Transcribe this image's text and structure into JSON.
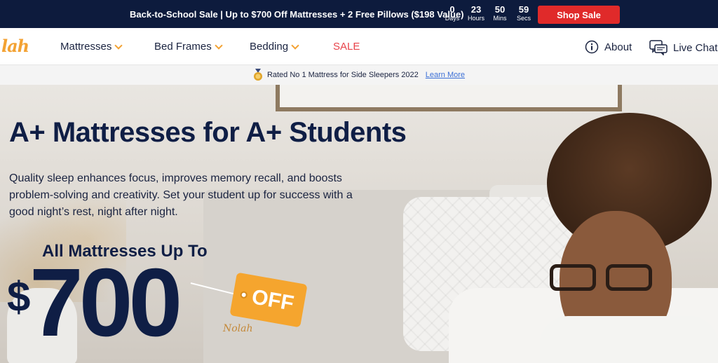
{
  "promo": {
    "text": "Back-to-School Sale | Up to $700 Off Mattresses + 2 Free Pillows ($198 Value)",
    "timer": [
      {
        "value": "0",
        "label": "Days"
      },
      {
        "value": "23",
        "label": "Hours"
      },
      {
        "value": "50",
        "label": "Mins"
      },
      {
        "value": "59",
        "label": "Secs"
      }
    ],
    "button": "Shop Sale",
    "button_color": "#e02a2a",
    "bg_color": "#0d1b3d"
  },
  "nav": {
    "logo": "lah",
    "items": [
      {
        "label": "Mattresses"
      },
      {
        "label": "Bed Frames"
      },
      {
        "label": "Bedding"
      },
      {
        "label": "SALE"
      }
    ],
    "about": "About",
    "chat": "Live Chat",
    "accent_color": "#f3a233",
    "sale_color": "#e8444b"
  },
  "rating": {
    "text": "Rated No 1 Mattress for Side Sleepers 2022",
    "link": "Learn More",
    "icon": "award-medal-icon"
  },
  "hero": {
    "title": "A+ Mattresses for A+ Students",
    "description": "Quality sleep enhances focus, improves memory recall, and boosts problem-solving and creativity. Set your student up for success with a good night’s rest, night after night.",
    "upto": "All Mattresses Up To",
    "dollar": "$",
    "amount": "700",
    "tag": "OFF",
    "signature": "Nolah",
    "title_color": "#0f1e45",
    "tag_color": "#f5a52e"
  }
}
